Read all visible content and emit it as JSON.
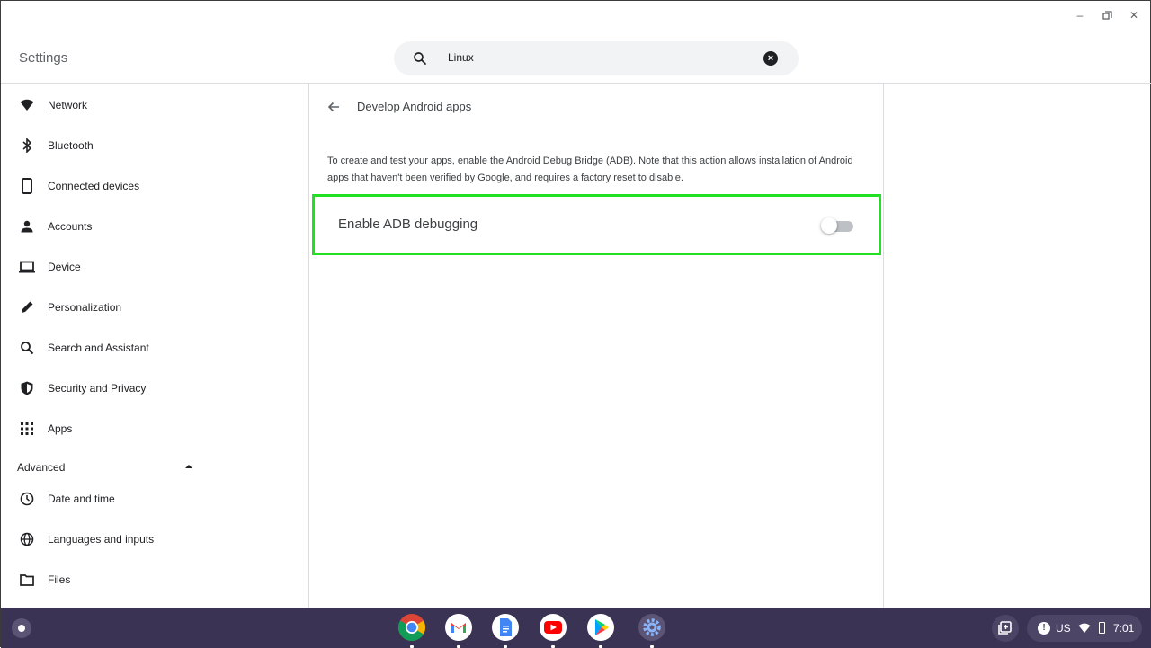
{
  "window": {
    "title": "Settings",
    "controls": [
      "minimize",
      "restore",
      "close"
    ]
  },
  "search": {
    "value": "Linux"
  },
  "sidebar": {
    "items": [
      {
        "label": "Network",
        "icon": "wifi-icon"
      },
      {
        "label": "Bluetooth",
        "icon": "bluetooth-icon"
      },
      {
        "label": "Connected devices",
        "icon": "phone-icon"
      },
      {
        "label": "Accounts",
        "icon": "person-icon"
      },
      {
        "label": "Device",
        "icon": "laptop-icon"
      },
      {
        "label": "Personalization",
        "icon": "pencil-icon"
      },
      {
        "label": "Search and Assistant",
        "icon": "search-icon"
      },
      {
        "label": "Security and Privacy",
        "icon": "shield-icon"
      },
      {
        "label": "Apps",
        "icon": "apps-grid-icon"
      }
    ],
    "advanced_label": "Advanced",
    "advanced_items": [
      {
        "label": "Date and time",
        "icon": "clock-icon"
      },
      {
        "label": "Languages and inputs",
        "icon": "globe-icon"
      },
      {
        "label": "Files",
        "icon": "folder-icon"
      }
    ]
  },
  "main": {
    "page_title": "Develop Android apps",
    "description": "To create and test your apps, enable the Android Debug Bridge (ADB). Note that this action allows installation of Android apps that haven't been verified by Google, and requires a factory reset to disable.",
    "adb_label": "Enable ADB debugging",
    "adb_enabled": false,
    "highlight_color": "#22e022"
  },
  "shelf": {
    "apps": [
      "chrome-icon",
      "gmail-icon",
      "docs-icon",
      "youtube-icon",
      "play-store-icon",
      "settings-icon"
    ],
    "status": {
      "language": "US",
      "time": "7:01"
    }
  }
}
